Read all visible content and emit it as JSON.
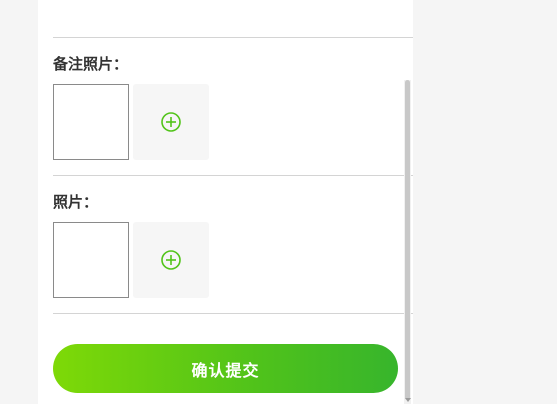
{
  "remark_photos": {
    "label": "备注照片："
  },
  "photos": {
    "label": "照片："
  },
  "submit": {
    "label": "确认提交"
  },
  "icons": {
    "add": "plus-circle-icon"
  },
  "colors": {
    "accent": "#52c41a",
    "button_gradient_start": "#7ed907",
    "button_gradient_end": "#37b52c",
    "label_text": "#333333",
    "divider": "#d4d4d4"
  }
}
